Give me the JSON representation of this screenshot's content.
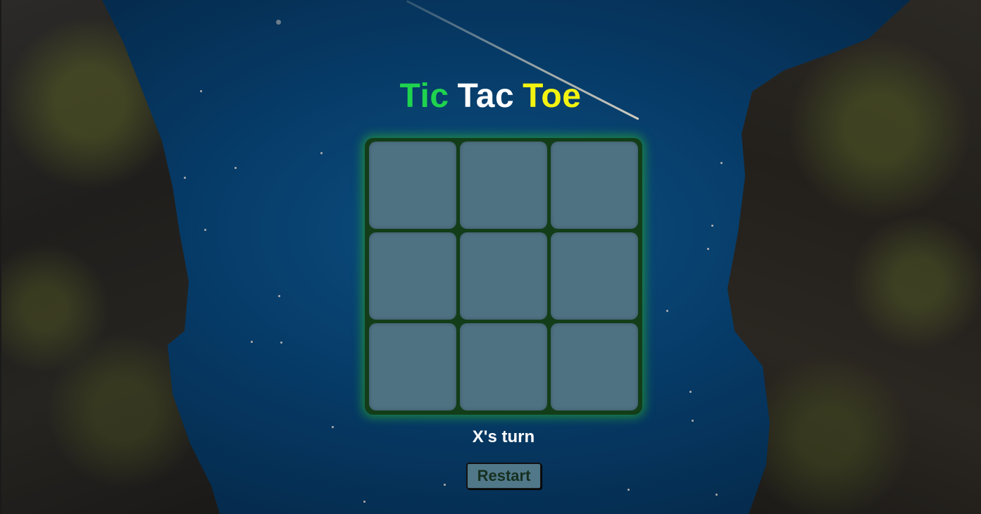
{
  "title": {
    "word1": "Tic",
    "word2": "Tac",
    "word3": "Toe"
  },
  "colors": {
    "tic": "#1fd34f",
    "tac": "#ffffff",
    "toe": "#f3f311",
    "board_glow": "#28aa32",
    "cell": "#4f7283",
    "restart_bg": "#507889"
  },
  "board": {
    "cells": [
      "",
      "",
      "",
      "",
      "",
      "",
      "",
      "",
      ""
    ]
  },
  "status": {
    "text": "X's turn"
  },
  "controls": {
    "restart_label": "Restart"
  }
}
